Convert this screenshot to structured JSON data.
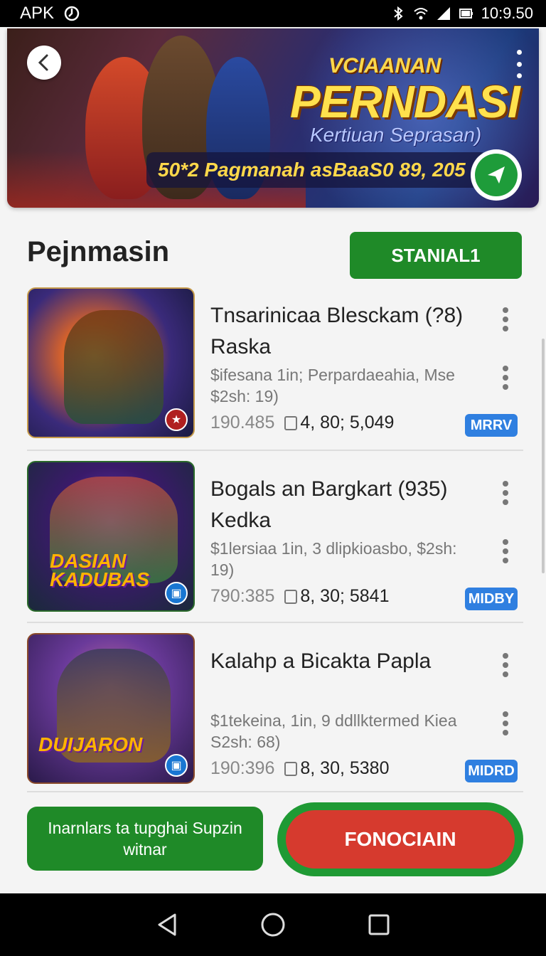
{
  "status_bar": {
    "left_label": "APK",
    "time": "10:9.50",
    "icons": [
      "settings-icon",
      "bluetooth-icon",
      "wifi-icon",
      "signal-icon",
      "battery-icon"
    ]
  },
  "banner": {
    "kicker": "VCIAANAN",
    "title": "PERNDASI",
    "subtitle": "Kertiuan Seprasan)",
    "pill_text": "50*2 Pagmanah asBaaS0 89, 205",
    "icons": [
      "back-icon",
      "more-icon",
      "share-icon"
    ]
  },
  "section": {
    "title": "Pejnmasin",
    "button_label": "STANIAL1"
  },
  "items": [
    {
      "title": "Tnsarinicaa Blesckam (?8) Raska",
      "meta": "$ifesana 1in; Perpardaeahia, Mse $2sh: 19)",
      "stat1": "190.485",
      "stat2": "4, 80; 5,049",
      "tag": "MRRV",
      "logo": "",
      "badge_icon": "logo-icon"
    },
    {
      "title": "Bogals an Bargkart (935) Kedka",
      "meta": "$1lersiaa 1in, 3 dlipkioasbo, $2sh: 19)",
      "stat1": "790:385",
      "stat2": "8, 30; 5841",
      "tag": "MIDBY",
      "logo": "DASIAN KADUBAS",
      "badge_icon": "bag-icon"
    },
    {
      "title": "Kalahp a Bicakta Papla",
      "meta": "$1tekeina, 1in, 9 ddllktermed Kiea S2sh: 68)",
      "stat1": "190:396",
      "stat2": "8, 30, 5380",
      "tag": "MIDRD",
      "logo": "DUIJARON",
      "badge_icon": "bag-icon"
    }
  ],
  "footer": {
    "left_button": "Inarnlars ta tupghai Supzin witnar",
    "right_button": "FONOCIAIN"
  },
  "nav": {
    "icons": [
      "back-triangle-icon",
      "home-circle-icon",
      "recents-square-icon"
    ]
  },
  "colors": {
    "primary_green": "#1f8a28",
    "accent_red": "#d63a2e",
    "tag_blue": "#2f7fe0"
  }
}
